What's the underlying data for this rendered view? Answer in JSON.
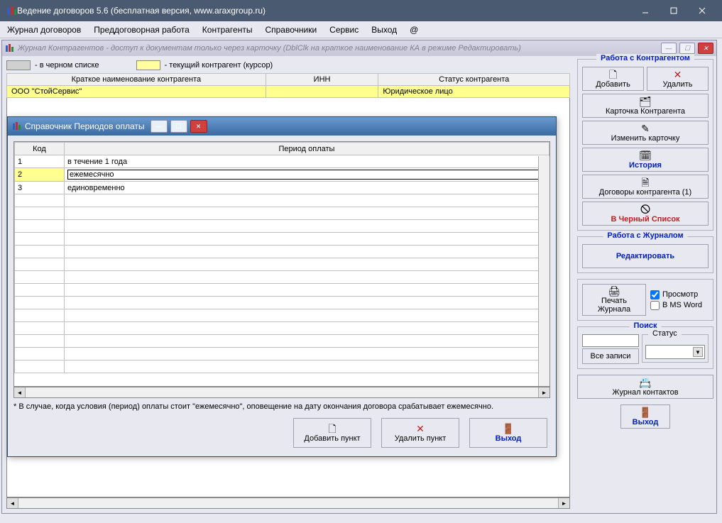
{
  "app": {
    "title": "Ведение договоров 5.6 (бесплатная версия, www.araxgroup.ru)"
  },
  "menu": {
    "items": [
      "Журнал договоров",
      "Преддоговорная работа",
      "Контрагенты",
      "Справочники",
      "Сервис",
      "Выход",
      "@"
    ]
  },
  "mdi": {
    "title": "Журнал Контрагентов - доступ к документам только через карточку (DblClk на краткое наименование КА в режиме Редактировать)",
    "legend_black": "- в черном списке",
    "legend_yellow": "- текущий контрагент (курсор)",
    "columns": {
      "name": "Краткое наименование контрагента",
      "inn": "ИНН",
      "status": "Статус контрагента"
    },
    "rows": [
      {
        "name": "ООО \"СтойСервис\"",
        "inn": "",
        "status": "Юридическое лицо"
      }
    ]
  },
  "sidebar": {
    "group1_title": "Работа с Контрагентом",
    "add": "Добавить",
    "delete": "Удалить",
    "card": "Карточка Контрагента",
    "edit_card": "Изменить карточку",
    "history": "История",
    "contracts": "Договоры контрагента (1)",
    "blacklist": "В Черный Список",
    "group2_title": "Работа с Журналом",
    "edit_journal": "Редактировать",
    "print": "Печать Журнала",
    "preview_chk": "Просмотр",
    "word_chk": "В MS Word",
    "search_title": "Поиск",
    "all_records": "Все записи",
    "status_label": "Статус",
    "contacts": "Журнал контактов",
    "exit": "Выход"
  },
  "dialog": {
    "title": "Справочник Периодов оплаты",
    "col_code": "Код",
    "col_period": "Период оплаты",
    "rows": [
      {
        "code": "1",
        "value": "в течение 1 года",
        "selected": false
      },
      {
        "code": "2",
        "value": "ежемесячно",
        "selected": true
      },
      {
        "code": "3",
        "value": "единовременно",
        "selected": false
      }
    ],
    "footnote": "* В случае, когда условия (период) оплаты стоит \"ежемесячно\", оповещение на дату окончания договора срабатывает ежемесячно.",
    "btn_add": "Добавить пункт",
    "btn_del": "Удалить пункт",
    "btn_exit": "Выход"
  }
}
